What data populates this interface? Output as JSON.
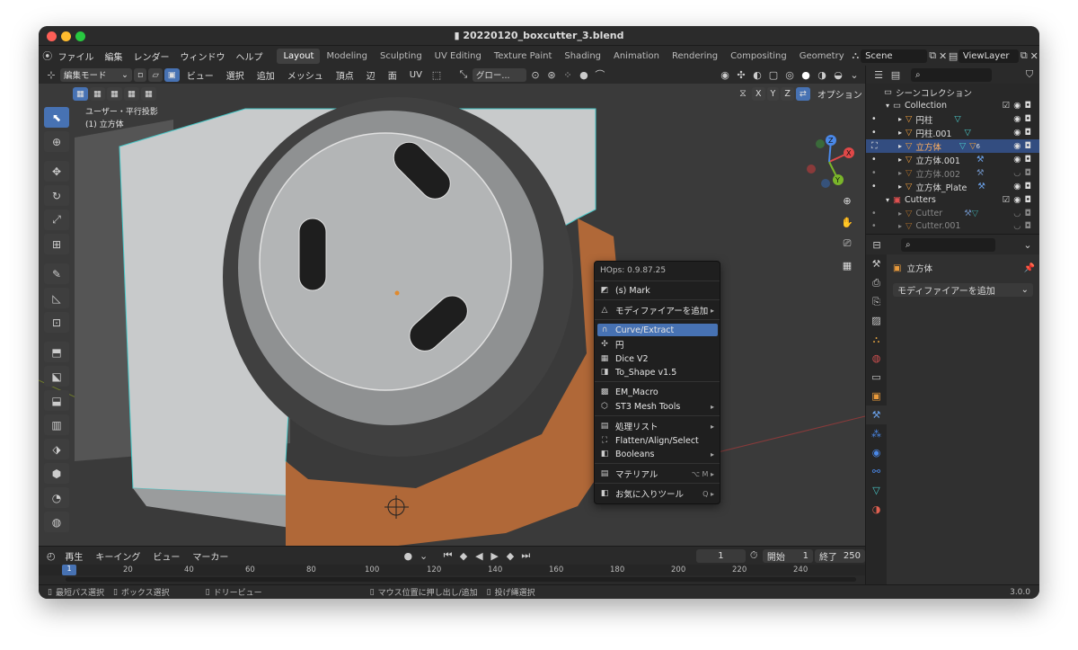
{
  "window": {
    "title": "20220120_boxcutter_3.blend"
  },
  "menubar": {
    "menus": [
      "ファイル",
      "編集",
      "レンダー",
      "ウィンドウ",
      "ヘルプ"
    ],
    "workspaces": [
      "Layout",
      "Modeling",
      "Sculpting",
      "UV Editing",
      "Texture Paint",
      "Shading",
      "Animation",
      "Rendering",
      "Compositing",
      "Geometry"
    ],
    "scene": "Scene",
    "view_layer": "ViewLayer"
  },
  "viewport_header": {
    "mode": "編集モード",
    "menus": [
      "ビュー",
      "選択",
      "追加",
      "メッシュ",
      "頂点",
      "辺",
      "面",
      "UV"
    ],
    "orientation": "グロー...",
    "axes": [
      "X",
      "Y",
      "Z"
    ],
    "options": "オプション"
  },
  "viewport": {
    "view_name": "ユーザー・平行投影",
    "object_name": "(1) 立方体"
  },
  "context_menu": {
    "title": "HOps: 0.9.87.25",
    "items": [
      {
        "label": "(s) Mark",
        "icon": "mark-icon",
        "submenu": false
      },
      {
        "label": "モディファイアーを追加",
        "icon": "modifier-icon",
        "submenu": true
      },
      {
        "label": "Curve/Extract",
        "icon": "curve-icon",
        "submenu": false,
        "highlight": true
      },
      {
        "label": "円",
        "icon": "circle-icon",
        "submenu": false
      },
      {
        "label": "Dice V2",
        "icon": "dice-icon",
        "submenu": false
      },
      {
        "label": "To_Shape v1.5",
        "icon": "shape-icon",
        "submenu": false
      },
      {
        "label": "EM_Macro",
        "icon": "macro-icon",
        "submenu": false
      },
      {
        "label": "ST3 Mesh Tools",
        "icon": "mesh-tools-icon",
        "submenu": true
      },
      {
        "label": "処理リスト",
        "icon": "list-icon",
        "submenu": true
      },
      {
        "label": "Flatten/Align/Select",
        "icon": "align-icon",
        "submenu": false
      },
      {
        "label": "Booleans",
        "icon": "boolean-icon",
        "submenu": true
      },
      {
        "label": "マテリアル",
        "icon": "material-icon",
        "submenu": false,
        "shortcut": "⌥ M"
      },
      {
        "label": "お気に入りツール",
        "icon": "favorites-icon",
        "submenu": false,
        "shortcut": "Q"
      }
    ]
  },
  "outliner": {
    "root": "シーンコレクション",
    "collection": "Collection",
    "objects": [
      "円柱",
      "円柱.001",
      "立方体",
      "立方体.001",
      "立方体.002",
      "立方体_Plate"
    ],
    "cutters_collection": "Cutters",
    "cutters": [
      "Cutter",
      "Cutter.001"
    ],
    "badge": "6"
  },
  "properties": {
    "object": "立方体",
    "add_modifier": "モディファイアーを追加"
  },
  "timeline": {
    "menus": [
      "再生",
      "キーイング",
      "ビュー",
      "マーカー"
    ],
    "current_frame": "1",
    "start_label": "開始",
    "start": "1",
    "end_label": "終了",
    "end": "250",
    "ticks": [
      "1",
      "20",
      "40",
      "60",
      "80",
      "100",
      "120",
      "140",
      "160",
      "180",
      "200",
      "220",
      "240"
    ]
  },
  "statusbar": {
    "items": [
      "最短パス選択",
      "ボックス選択",
      "ドリービュー",
      "マウス位置に押し出し/追加",
      "投げ縄選択"
    ],
    "version": "3.0.0"
  }
}
